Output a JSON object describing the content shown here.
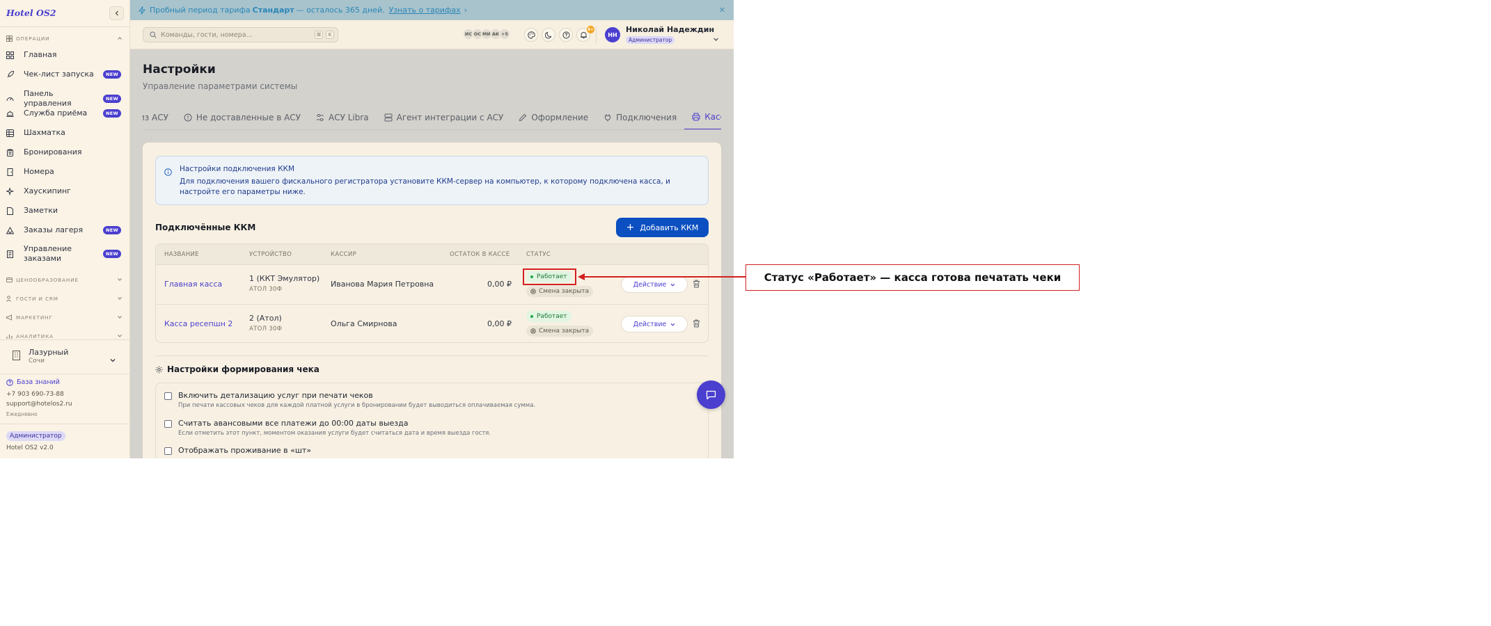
{
  "sidebar": {
    "brand": "Hotel OS2",
    "sections": {
      "operations": "Операции",
      "pricing": "Ценообразование",
      "guests": "Гости и CRM",
      "marketing": "Маркетинг",
      "analytics": "Аналитика"
    },
    "items": [
      {
        "label": "Главная",
        "icon": "grid-icon",
        "badge": ""
      },
      {
        "label": "Чек-лист запуска",
        "icon": "rocket-icon",
        "badge": "NEW"
      },
      {
        "label": "Панель управления",
        "icon": "gauge-icon",
        "badge": "NEW"
      },
      {
        "label": "Служба приёма",
        "icon": "bell-service-icon",
        "badge": "NEW"
      },
      {
        "label": "Шахматка",
        "icon": "table-grid-icon",
        "badge": ""
      },
      {
        "label": "Бронирования",
        "icon": "clipboard-icon",
        "badge": ""
      },
      {
        "label": "Номера",
        "icon": "door-icon",
        "badge": ""
      },
      {
        "label": "Хаускипинг",
        "icon": "sparkles-icon",
        "badge": ""
      },
      {
        "label": "Заметки",
        "icon": "note-icon",
        "badge": ""
      },
      {
        "label": "Заказы лагеря",
        "icon": "tent-icon",
        "badge": "NEW"
      },
      {
        "label": "Управление заказами",
        "icon": "orders-icon",
        "badge": "NEW"
      }
    ],
    "hotel": {
      "name": "Лазурный",
      "city": "Сочи"
    },
    "knowledge_base": "База знаний",
    "phone": "+7 903 690-73-88",
    "email": "support@hotelos2.ru",
    "schedule": "Ежедневно",
    "role": "Администратор",
    "version": "Hotel OS2 v2.0"
  },
  "banner": {
    "prefix": "Пробный период тарифа",
    "plan": "Стандарт",
    "suffix": "— осталось 365 дней.",
    "link": "Узнать о тарифах",
    "link_arrow": "›",
    "close": "✕"
  },
  "header": {
    "search_placeholder": "Команды, гости, номера...",
    "kbd_cmd": "⌘",
    "kbd_k": "K",
    "avatars": [
      "ИС",
      "ОС",
      "МИ",
      "АК",
      "+5"
    ],
    "notifications": "9+",
    "user_initials": "НН",
    "user_name": "Николай Надеждин",
    "user_role": "Администратор"
  },
  "page": {
    "title": "Настройки",
    "subtitle": "Управление параметрами системы",
    "tabs": [
      {
        "label": "из АСУ",
        "icon": ""
      },
      {
        "label": "Не доставленные в АСУ",
        "icon": "alert-circle-icon"
      },
      {
        "label": "АСУ Libra",
        "icon": "sliders-icon"
      },
      {
        "label": "Агент интеграции с АСУ",
        "icon": "server-icon"
      },
      {
        "label": "Оформление",
        "icon": "pen-icon"
      },
      {
        "label": "Подключения",
        "icon": "plug-icon"
      },
      {
        "label": "Кассы",
        "icon": "printer-icon"
      }
    ],
    "active_tab": "Кассы"
  },
  "kkm": {
    "info_title": "Настройки подключения ККМ",
    "info_text": "Для подключения вашего фискального регистратора установите ККМ-сервер на компьютер, к которому подключена касса, и настройте его параметры ниже.",
    "section_title": "Подключённые ККМ",
    "add_button": "Добавить ККМ",
    "columns": [
      "Название",
      "Устройство",
      "Кассир",
      "Остаток в кассе",
      "Статус"
    ],
    "rows": [
      {
        "name": "Главная касса",
        "device": "1 (ККТ Эмулятор)",
        "model": "АТОЛ 30Ф",
        "cashier": "Иванова Мария Петровна",
        "balance": "0,00 ₽",
        "status": "Работает",
        "shift": "Смена закрыта",
        "action": "Действие"
      },
      {
        "name": "Касса ресепшн 2",
        "device": "2 (Атол)",
        "model": "АТОЛ 30Ф",
        "cashier": "Ольга Смирнова",
        "balance": "0,00 ₽",
        "status": "Работает",
        "shift": "Смена закрыта",
        "action": "Действие"
      }
    ]
  },
  "receipt": {
    "title": "Настройки формирования чека",
    "options": [
      {
        "label": "Включить детализацию услуг при печати чеков",
        "desc": "При печати кассовых чеков для каждой платной услуги в бронировании будет выводиться оплачиваемая сумма.",
        "checked": false
      },
      {
        "label": "Считать авансовыми все платежи до 00:00 даты выезда",
        "desc": "Если отметить этот пункт, моментом оказания услуги будет считаться дата и время выезда гостя.",
        "checked": false
      },
      {
        "label": "Отображать проживание в «шт»",
        "desc": "",
        "checked": false
      }
    ]
  },
  "annotation": {
    "text": "Статус «Работает» — касса готова печатать чеки"
  },
  "colors": {
    "accent": "#4b3fcf",
    "primary_button": "#0b4fc0",
    "status_ok": "#1d7a35",
    "annotation": "#d31f1f"
  }
}
